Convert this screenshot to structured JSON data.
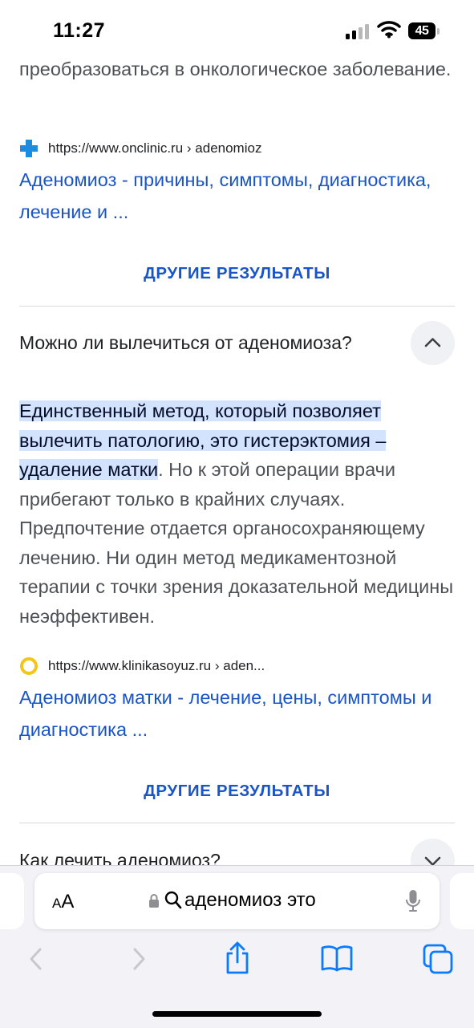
{
  "status_bar": {
    "time": "11:27",
    "battery": "45"
  },
  "page": {
    "continued_text": "преобразоваться в онкологическое заболевание.",
    "result1": {
      "url": "https://www.onclinic.ru › adenomioz",
      "title": "Аденомиоз - причины, симптомы, диагностика, лечение и ...",
      "favicon_icon": "medical-cross-icon",
      "favicon_color": "#1a8de0"
    },
    "more_results_label": "ДРУГИЕ РЕЗУЛЬТАТЫ",
    "faq1": {
      "question": "Можно ли вылечиться от аденомиоза?",
      "answer_highlight": "Единственный метод, который позволяет вылечить патологию, это гистерэктомия – удаление матки",
      "answer_rest": ". Но к этой операции врачи прибегают только в крайних случаях. Предпочтение отдается органосохраняющему лечению. Ни один метод медикаментозной терапии с точки зрения доказательной медицины неэффективен.",
      "expanded_icon": "chevron-up-icon"
    },
    "result2": {
      "url": "https://www.klinikasoyuz.ru › aden...",
      "title": "Аденомиоз матки - лечение, цены, симптомы и диагностика ...",
      "favicon_icon": "ring-icon",
      "favicon_color": "#f5c518"
    },
    "more_results_label_2": "ДРУГИЕ РЕЗУЛЬТАТЫ",
    "faq2": {
      "question": "Как лечить аденомиоз?",
      "collapsed_icon": "chevron-down-icon"
    }
  },
  "address_bar": {
    "aa_small": "A",
    "aa_large": "A",
    "query": "аденомиоз это"
  },
  "colors": {
    "link": "#1a55c8",
    "highlight": "#d3e3fd",
    "toolbar_icon": "#0a7aff"
  }
}
